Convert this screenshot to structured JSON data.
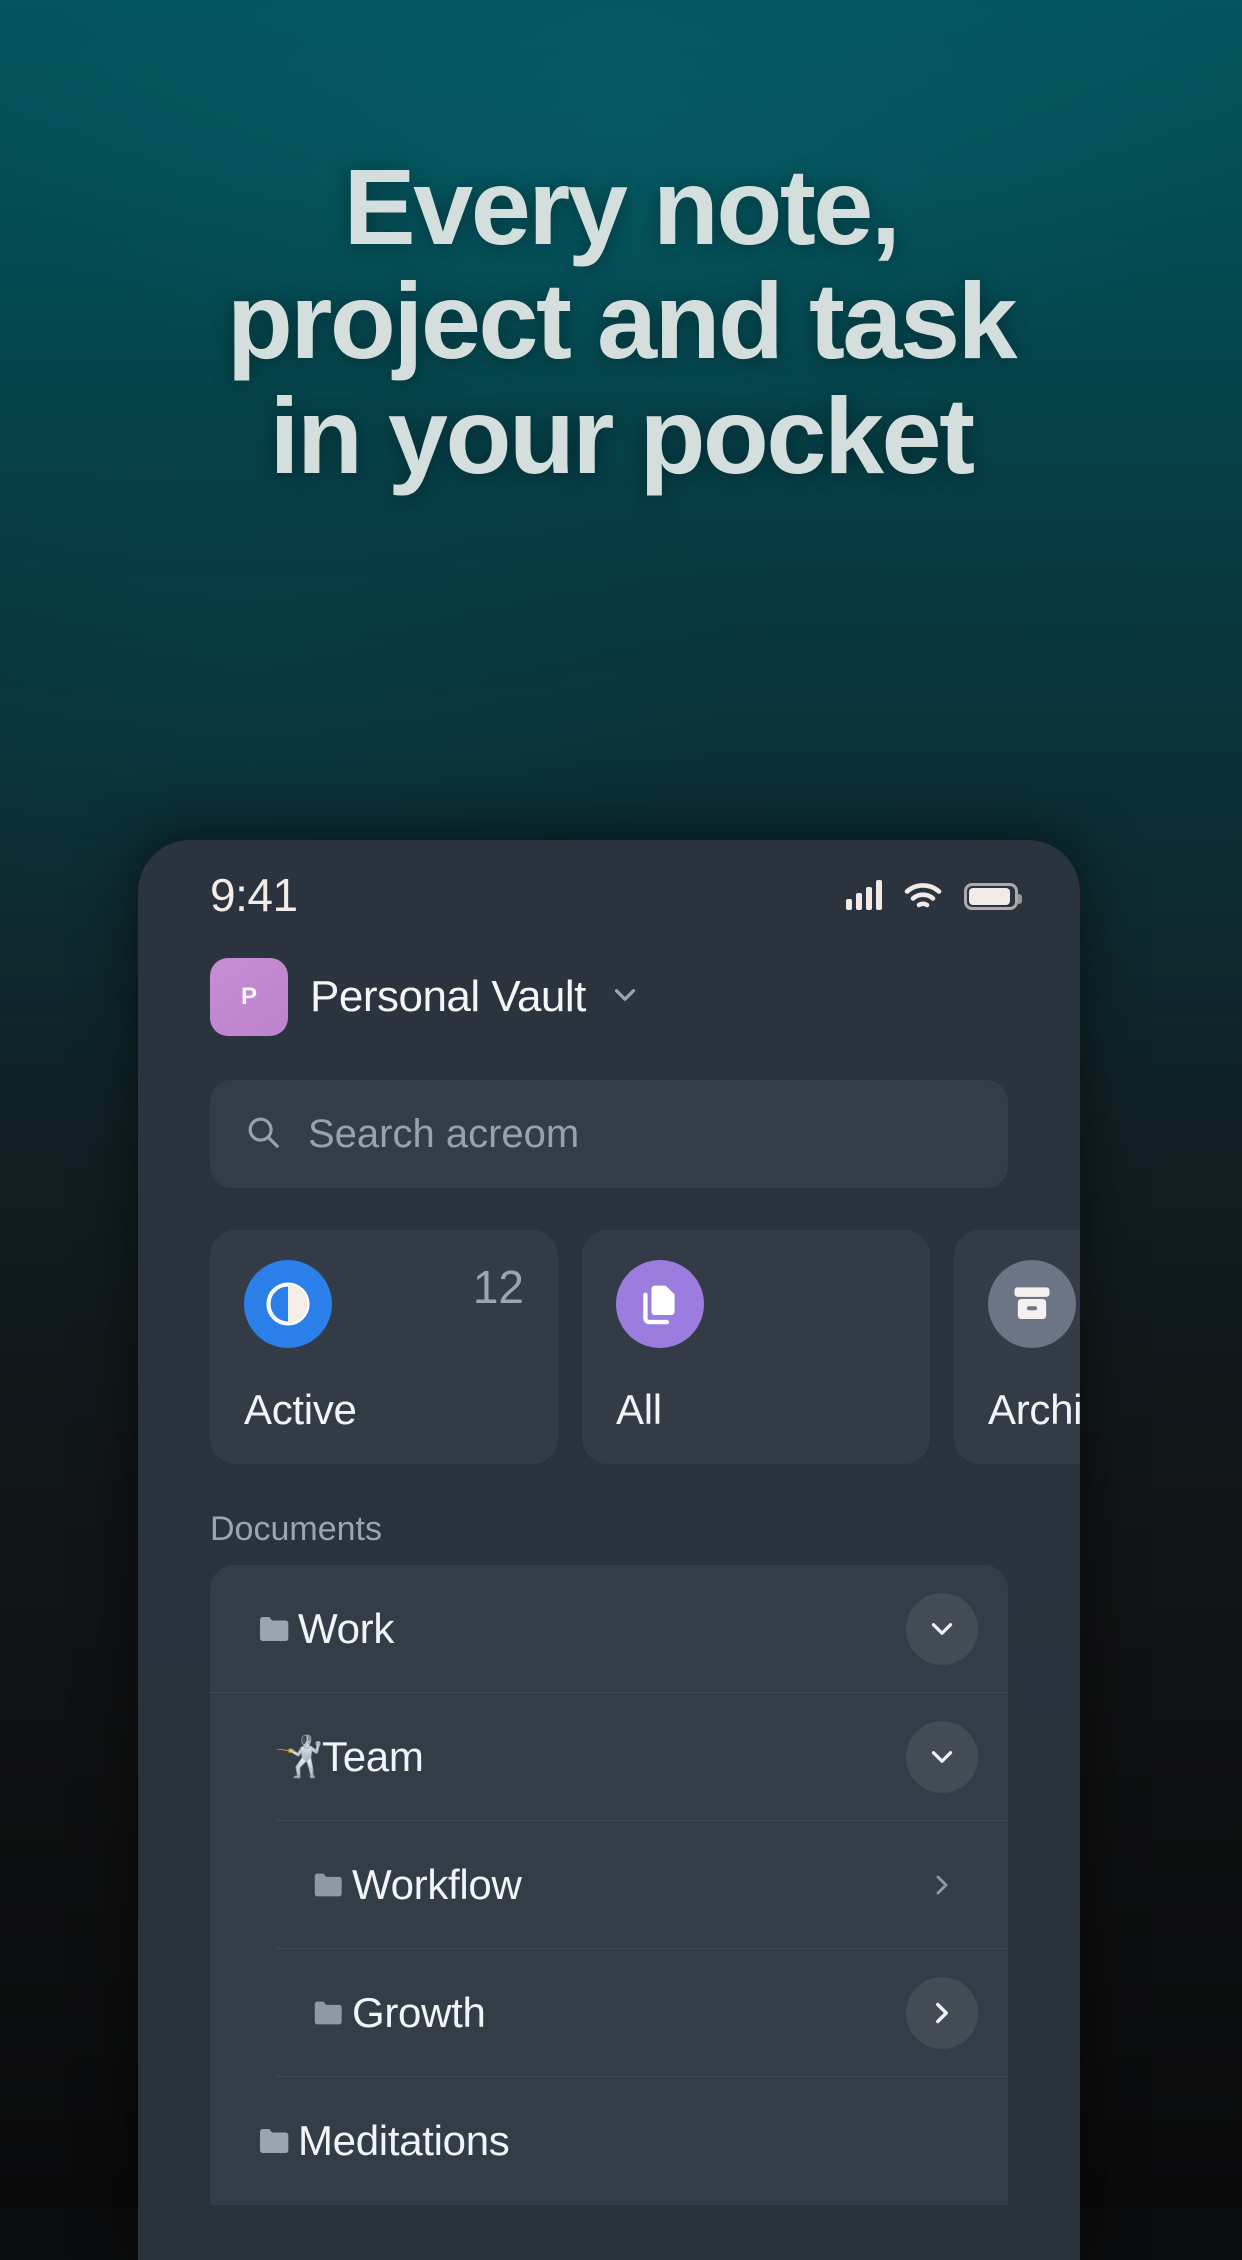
{
  "marketing": {
    "headline_lines": [
      "Every note,",
      "project and task",
      "in your pocket"
    ],
    "background_top_color": "#02555d",
    "background_bottom_color": "#0a0a0b",
    "headline_color": "#d4dedd"
  },
  "phone": {
    "status_bar": {
      "time": "9:41",
      "signal_icon": "cellular-signal-icon",
      "wifi_icon": "wifi-icon",
      "battery_icon": "battery-icon"
    },
    "vault": {
      "avatar_initial": "P",
      "avatar_color": "#bd82cd",
      "name": "Personal Vault",
      "chevron_icon": "chevron-down-icon"
    },
    "search": {
      "placeholder": "Search acreom",
      "icon": "search-icon"
    },
    "cards": [
      {
        "label": "Active",
        "count": "12",
        "icon": "contrast-half-circle-icon",
        "icon_color": "#2b7fe8"
      },
      {
        "label": "All",
        "count": "",
        "icon": "copy-documents-icon",
        "icon_color": "#9b7de0"
      },
      {
        "label": "Archive",
        "count": "",
        "icon": "archive-box-icon",
        "icon_color": "#6b7585"
      }
    ],
    "documents": {
      "section_label": "Documents",
      "rows": [
        {
          "label": "Work",
          "icon": "folder-icon",
          "indent": 0,
          "action_icon": "chevron-down-icon",
          "highlighted": true
        },
        {
          "label": "Team",
          "icon": "fencer-emoji",
          "emoji": "🤺",
          "indent": 1,
          "action_icon": "chevron-down-icon",
          "highlighted": true
        },
        {
          "label": "Workflow",
          "icon": "folder-icon",
          "indent": 2,
          "action_icon": "chevron-right-icon",
          "highlighted": false
        },
        {
          "label": "Growth",
          "icon": "folder-icon",
          "indent": 2,
          "action_icon": "chevron-right-icon",
          "highlighted": true
        },
        {
          "label": "Meditations",
          "icon": "folder-icon",
          "indent": 0,
          "action_icon": "",
          "highlighted": false
        }
      ]
    }
  }
}
